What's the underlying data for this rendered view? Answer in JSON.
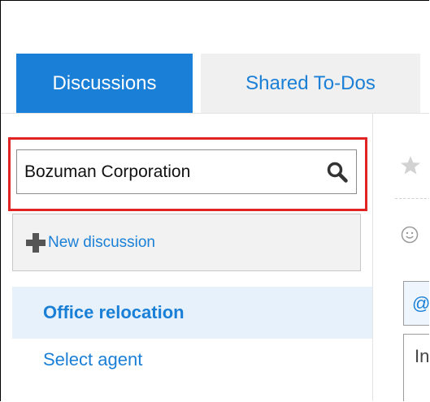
{
  "tabs": [
    {
      "label": "Discussions",
      "active": true
    },
    {
      "label": "Shared To-Dos",
      "active": false
    }
  ],
  "sidebar": {
    "search": {
      "value": "Bozuman Corporation",
      "icon": "search-icon"
    },
    "new_discussion": {
      "label": "New discussion",
      "icon": "plus-icon"
    },
    "items": [
      {
        "label": "Office relocation",
        "selected": true
      },
      {
        "label": "Select agent",
        "selected": false
      }
    ]
  },
  "panel": {
    "mention_label": "@",
    "input_text": "In",
    "icons": [
      "star-icon",
      "smiley-icon"
    ]
  },
  "colors": {
    "accent": "#1a7fd6",
    "tab_inactive_bg": "#f0f0f0",
    "highlight_border": "#e02424",
    "selected_item_bg": "#e6f1fb"
  }
}
